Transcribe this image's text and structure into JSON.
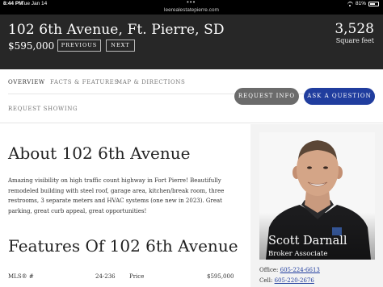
{
  "status_bar": {
    "time": "8:44 PM",
    "date": "Tue Jan 14",
    "url": "leerealestatepierre.com",
    "battery": "81%"
  },
  "listing": {
    "title": "102 6th Avenue, Ft. Pierre, SD",
    "price": "$595,000",
    "previous_label": "PREVIOUS",
    "next_label": "NEXT",
    "square_feet_value": "3,528",
    "square_feet_label": "Square feet"
  },
  "tabs": {
    "overview": "OVERVIEW",
    "facts": "FACTS & FEATURES",
    "map": "MAP & DIRECTIONS",
    "showing": "REQUEST SHOWING"
  },
  "actions": {
    "request_info": "REQUEST INFO",
    "ask_question": "ASK A QUESTION"
  },
  "about": {
    "heading": "About 102 6th Avenue",
    "description": "Amazing visibility on high traffic count highway in Fort Pierre! Beautifully remodeled building with steel roof, garage area, kitchen/break room, three restrooms, 3 separate meters and HVAC systems (one new in 2023). Great parking, great curb appeal, great opportunities!"
  },
  "features": {
    "heading": "Features Of 102 6th Avenue",
    "mls_label": "MLS® #",
    "mls_value": "24-236",
    "price_label": "Price",
    "price_value": "$595,000"
  },
  "agent": {
    "name": "Scott Darnall",
    "role": "Broker Associate",
    "office_label": "Office:",
    "office_phone": "605-224-6613",
    "cell_label": "Cell:",
    "cell_phone": "605-220-2676"
  },
  "colors": {
    "header_bg": "#272727",
    "ask_button": "#203d9e",
    "info_button": "#6b6b6b"
  }
}
